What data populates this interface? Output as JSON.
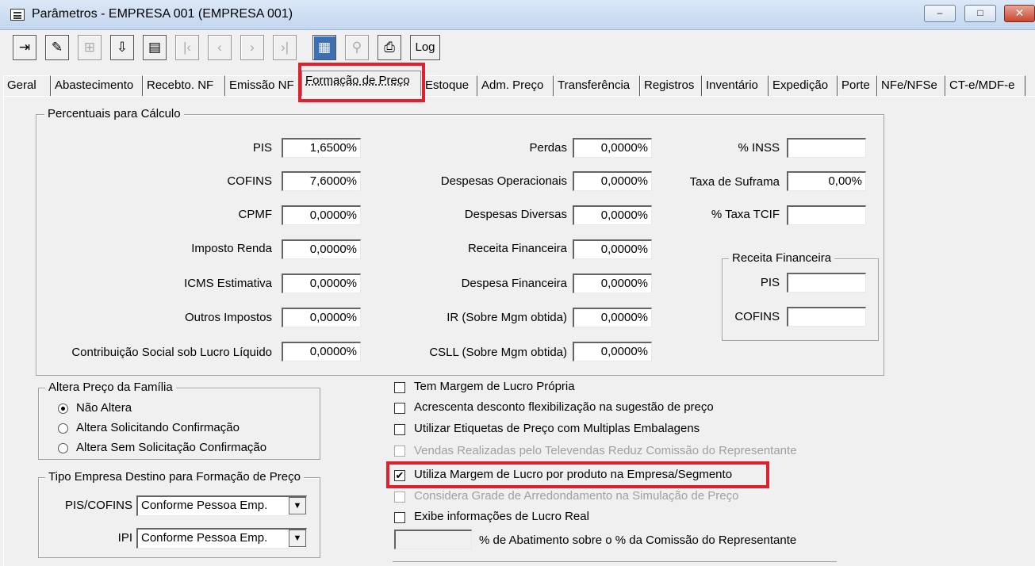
{
  "window": {
    "title": "Parâmetros - EMPRESA 001 (EMPRESA 001)",
    "minimize": "–",
    "maximize": "□",
    "close": "✕"
  },
  "toolbar": {
    "log_label": "Log",
    "icons": [
      "exit-icon",
      "eraser-icon",
      "new-record-icon",
      "import-icon",
      "export-icon",
      "first-icon",
      "prev-icon",
      "next-icon",
      "last-icon",
      "grid-icon",
      "query-icon",
      "print-icon"
    ]
  },
  "tabs": [
    {
      "label": "Geral"
    },
    {
      "label": "Abastecimento"
    },
    {
      "label": "Recebto. NF"
    },
    {
      "label": "Emissão NF"
    },
    {
      "label": "Formação de Preço",
      "active": true
    },
    {
      "label": "Estoque"
    },
    {
      "label": "Adm. Preço"
    },
    {
      "label": "Transferência"
    },
    {
      "label": "Registros"
    },
    {
      "label": "Inventário"
    },
    {
      "label": "Expedição"
    },
    {
      "label": "Porte"
    },
    {
      "label": "NFe/NFSe"
    },
    {
      "label": "CT-e/MDF-e"
    }
  ],
  "percentuais": {
    "legend": "Percentuais para Cálculo",
    "col1": [
      {
        "label": "PIS",
        "value": "1,6500%"
      },
      {
        "label": "COFINS",
        "value": "7,6000%"
      },
      {
        "label": "CPMF",
        "value": "0,0000%"
      },
      {
        "label": "Imposto Renda",
        "value": "0,0000%"
      },
      {
        "label": "ICMS Estimativa",
        "value": "0,0000%"
      },
      {
        "label": "Outros Impostos",
        "value": "0,0000%"
      },
      {
        "label": "Contribuição Social sob Lucro Líquido",
        "value": "0,0000%"
      }
    ],
    "col2": [
      {
        "label": "Perdas",
        "value": "0,0000%"
      },
      {
        "label": "Despesas Operacionais",
        "value": "0,0000%"
      },
      {
        "label": "Despesas Diversas",
        "value": "0,0000%"
      },
      {
        "label": "Receita Financeira",
        "value": "0,0000%"
      },
      {
        "label": "Despesa Financeira",
        "value": "0,0000%"
      },
      {
        "label": "IR (Sobre Mgm obtida)",
        "value": "0,0000%"
      },
      {
        "label": "CSLL (Sobre Mgm obtida)",
        "value": "0,0000%"
      }
    ],
    "col3": [
      {
        "label": "% INSS",
        "value": ""
      },
      {
        "label": "Taxa de Suframa",
        "value": "0,00%"
      },
      {
        "label": "% Taxa TCIF",
        "value": ""
      }
    ],
    "receita": {
      "legend": "Receita Financeira",
      "pis_label": "PIS",
      "pis_value": "",
      "cofins_label": "COFINS",
      "cofins_value": ""
    }
  },
  "altera_preco": {
    "legend": "Altera Preço da Família",
    "options": [
      {
        "label": "Não Altera",
        "selected": true
      },
      {
        "label": "Altera Solicitando Confirmação",
        "selected": false
      },
      {
        "label": "Altera Sem Solicitação Confirmação",
        "selected": false
      }
    ]
  },
  "tipo_empresa": {
    "legend": "Tipo Empresa Destino para Formação de Preço",
    "pis_cofins_label": "PIS/COFINS",
    "pis_cofins_value": "Conforme Pessoa Emp.",
    "ipi_label": "IPI",
    "ipi_value": "Conforme Pessoa Emp."
  },
  "checkboxes": [
    {
      "label": "Tem Margem de Lucro Própria",
      "checked": false,
      "disabled": false
    },
    {
      "label": "Acrescenta desconto flexibilização na sugestão de preço",
      "checked": false,
      "disabled": false
    },
    {
      "label": "Utilizar Etiquetas de Preço com Multiplas Embalagens",
      "checked": false,
      "disabled": false
    },
    {
      "label": "Vendas Realizadas pelo Televendas Reduz Comissão do Representante",
      "checked": false,
      "disabled": true
    },
    {
      "label": "Utiliza Margem de Lucro por produto na Empresa/Segmento",
      "checked": true,
      "disabled": false
    },
    {
      "label": "Considera Grade de Arredondamento na Simulação de Preço",
      "checked": false,
      "disabled": true
    },
    {
      "label": "Exibe informações de Lucro Real",
      "checked": false,
      "disabled": false
    }
  ],
  "abatimento": {
    "label": "% de Abatimento sobre o % da Comissão do Representante",
    "value": ""
  },
  "check_mark": "✔"
}
